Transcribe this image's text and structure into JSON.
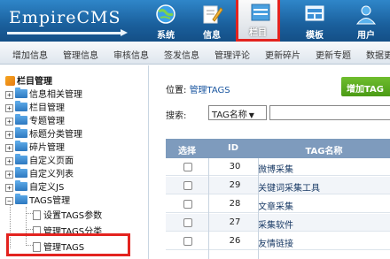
{
  "header": {
    "logo_text": "EmpireCMS",
    "nav": [
      {
        "label": "系统",
        "icon": "globe-icon"
      },
      {
        "label": "信息",
        "icon": "edit-icon"
      },
      {
        "label": "栏目",
        "icon": "column-icon",
        "active": true
      },
      {
        "label": "模板",
        "icon": "template-icon"
      },
      {
        "label": "用户",
        "icon": "user-icon"
      }
    ]
  },
  "menubar": {
    "items": [
      "增加信息",
      "管理信息",
      "审核信息",
      "签发信息",
      "管理评论",
      "更新碎片",
      "更新专题",
      "数据更新"
    ]
  },
  "sidebar": {
    "title": "栏目管理",
    "tree": [
      "信息相关管理",
      "栏目管理",
      "专题管理",
      "标题分类管理",
      "碎片管理",
      "自定义页面",
      "自定义列表",
      "自定义JS",
      "TAGS管理"
    ],
    "tags_children": [
      "设置TAGS参数",
      "管理TAGS分类",
      "管理TAGS"
    ]
  },
  "main": {
    "location_label": "位置:",
    "location_link": "管理TAGS",
    "add_button": "增加TAG",
    "search_label": "搜索:",
    "search_select": "TAG名称",
    "search_input_value": "",
    "table": {
      "columns": [
        "选择",
        "ID",
        "TAG名称"
      ],
      "rows": [
        {
          "id": "30",
          "name": "微博采集"
        },
        {
          "id": "29",
          "name": "关键词采集工具"
        },
        {
          "id": "28",
          "name": "文章采集"
        },
        {
          "id": "27",
          "name": "采集软件"
        },
        {
          "id": "26",
          "name": "友情链接"
        }
      ]
    }
  },
  "colors": {
    "header_blue": "#1a5f9c",
    "highlight_red": "#e3231f",
    "table_header": "#7e9bbd",
    "add_button_green": "#4b9b15"
  }
}
